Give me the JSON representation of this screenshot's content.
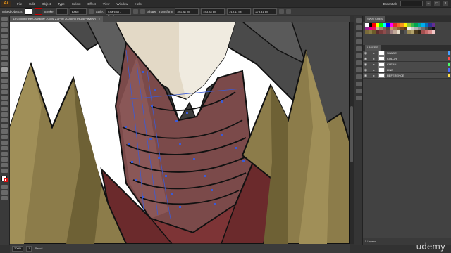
{
  "app": {
    "logo": "Ai",
    "menu": [
      "File",
      "Edit",
      "Object",
      "Type",
      "Select",
      "Effect",
      "View",
      "Window",
      "Help"
    ],
    "workspace": "Essentials",
    "window_buttons": [
      "–",
      "□",
      "×"
    ]
  },
  "control_bar": {
    "selection_label": "Mixed Objects",
    "stroke_label": "Stroke:",
    "brush_preset": "Basic",
    "style_label": "Style:",
    "shape_label": "Shape",
    "transform_label": "Transform",
    "x_value": "391.88 px",
    "y_value": "493.83 px",
    "w_value": "219.11 px",
    "h_value": "273.41 px",
    "brush_name": "Charcoal - Feather"
  },
  "document": {
    "tab_title": "13 Coloring the Character - Copy 2.ai* @ 200.05% (RGB/Preview)",
    "close_symbol": "×"
  },
  "status_bar": {
    "zoom": "200%",
    "artboard": "1",
    "tool_name": "Pencil"
  },
  "panels": {
    "swatches_tab": "SWATCHES",
    "layers_tab": "LAYERS",
    "layers": [
      {
        "name": "SHADE",
        "color": "#4aa0ff"
      },
      {
        "name": "COLOR",
        "color": "#ff4a4a"
      },
      {
        "name": "CLEAN",
        "color": "#4aff6a"
      },
      {
        "name": "LINE",
        "color": "#4a6aff"
      },
      {
        "name": "REFERENCE",
        "color": "#ffdf4a"
      }
    ],
    "layers_footer": "5 Layers",
    "swatch_colors": [
      "#ffffff",
      "#000000",
      "#ff0000",
      "#ffff00",
      "#00ff00",
      "#00ffff",
      "#0000ff",
      "#ff00ff",
      "#e8262a",
      "#f26522",
      "#f7941d",
      "#fff200",
      "#8dc63f",
      "#39b54a",
      "#00a651",
      "#00a99d",
      "#00aeef",
      "#0072bc",
      "#2e3192",
      "#662d91",
      "#92278f",
      "#ec008c",
      "#ed145b",
      "#c2b59b",
      "#998675",
      "#736357",
      "#534741",
      "#c69c6d",
      "#a67c52",
      "#8c6239",
      "#754c24",
      "#603913",
      "#f0f0f0",
      "#d0d0d0",
      "#b0b0b0",
      "#909090",
      "#707070",
      "#505050",
      "#303030",
      "#101010",
      "#7a6b3a",
      "#8a7d45",
      "#6d5c2b",
      "#5c2c2c",
      "#7a3b3b",
      "#8e4d4d",
      "#6b4c4c",
      "#a08080",
      "#c0a898",
      "#e6dcc8",
      "#3c3c3c",
      "#545454",
      "#9b8a55",
      "#b3a26a",
      "#4a3a1e",
      "#2d2416",
      "#a35050",
      "#c76b6b",
      "#d98c8c",
      "#f0c8c8"
    ]
  },
  "watermark": "udemy"
}
